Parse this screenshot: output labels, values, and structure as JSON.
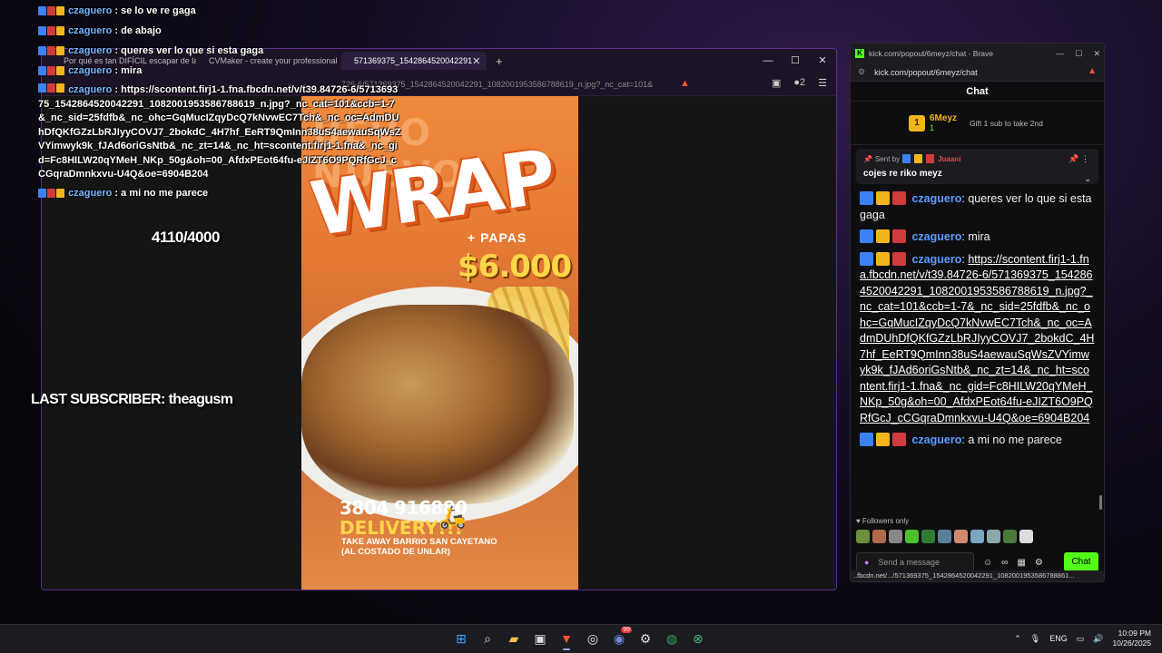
{
  "overlay_chat": {
    "messages": [
      {
        "user": "czaguero",
        "sep": " : ",
        "text": "se lo ve re gaga"
      },
      {
        "user": "czaguero",
        "sep": " : ",
        "text": "de abajo"
      },
      {
        "user": "czaguero",
        "sep": " : ",
        "text": "queres ver lo que si esta gaga"
      },
      {
        "user": "czaguero",
        "sep": " : ",
        "text": "mira"
      },
      {
        "user": "czaguero",
        "sep": " : ",
        "text": "https://scontent.firj1-1.fna.fbcdn.net/v/t39.84726-6/571369375_1542864520042291_1082001953586788619_n.jpg?_nc_cat=101&ccb=1-7&_nc_sid=25fdfb&_nc_ohc=GqMucIZqyDcQ7kNvwEC7Tch&_nc_oc=AdmDUhDfQKfGZzLbRJIyyCOVJ7_2bokdC_4H7hf_EeRT9QmInn38uS4aewauSqWsZVYimwyk9k_fJAd6oriGsNtb&_nc_zt=14&_nc_ht=scontent.firj1-1.fna&_nc_gid=Fc8HILW20qYMeH_NKp_50g&oh=00_AfdxPEot64fu-eJIZT6O9PQRfGcJ_cCGqraDmnkxvu-U4Q&oe=6904B204"
      },
      {
        "user": "czaguero",
        "sep": " : ",
        "text": "a mi no me parece"
      }
    ],
    "counter": "4110/4000",
    "last_subscriber": "LAST SUBSCRIBER: theagusm"
  },
  "browser": {
    "tabs": [
      {
        "label": "Por qué es tan DIFÍCIL escapar de la"
      },
      {
        "label": "CVMaker - create your professional"
      },
      {
        "label": "571369375_1542864520042291"
      }
    ],
    "new_tab": "+",
    "address_fragment": "726-6/571369375_1542864520042291_1082001953586788619_n.jpg?_nc_cat=101&",
    "extension_count": "2"
  },
  "poster": {
    "arch_text": "UEVO NUEVO",
    "title": "WRAP",
    "subtitle": "+ PAPAS",
    "price": "$6.000",
    "phone": "3804 916880",
    "delivery": "DELIVERY!!!",
    "takeaway": "TAKE AWAY BARRIO SAN CAYETANO",
    "location": "(AL COSTADO DE UNLAR)"
  },
  "kick": {
    "window_title": "kick.com/popout/6meyz/chat - Brave",
    "url": "kick.com/popout/6meyz/chat",
    "header": "Chat",
    "gift": {
      "rank": "1",
      "user": "6Meyz",
      "count": "1",
      "text": "Gift 1 sub to take 2nd"
    },
    "pinned": {
      "sent_by_label": "Sent by",
      "sent_by_user": "Juaani",
      "message": "cojes re riko meyz"
    },
    "messages": [
      {
        "user": "czaguero",
        "text": ": queres ver lo que si esta gaga",
        "link": ""
      },
      {
        "user": "czaguero",
        "text": ": mira",
        "link": ""
      },
      {
        "user": "czaguero",
        "text": ": ",
        "link": "https://scontent.firj1-1.fna.fbcdn.net/v/t39.84726-6/571369375_1542864520042291_1082001953586788619_n.jpg?_nc_cat=101&ccb=1-7&_nc_sid=25fdfb&_nc_ohc=GqMucIZqyDcQ7kNvwEC7Tch&_nc_oc=AdmDUhDfQKfGZzLbRJIyyCOVJ7_2bokdC_4H7hf_EeRT9QmInn38uS4aewauSqWsZVYimwyk9k_fJAd6oriGsNtb&_nc_zt=14&_nc_ht=scontent.firj1-1.fna&_nc_gid=Fc8HILW20qYMeH_NKp_50g&oh=00_AfdxPEot64fu-eJIZT6O9PQRfGcJ_cCGqraDmnkxvu-U4Q&oe=6904B204"
      },
      {
        "user": "czaguero",
        "text": ": a mi no me parece",
        "link": ""
      }
    ],
    "followers_only": "Followers only",
    "input_placeholder": "Send a message",
    "chat_button": "Chat",
    "status_url": "..fbcdn.net/.../571369375_1542864520042291_1082001953586788861..."
  },
  "taskbar": {
    "language": "ENG",
    "time": "10:09 PM",
    "date": "10/26/2025",
    "discord_badge": "99"
  },
  "colors": {
    "kick_green": "#53fc18",
    "username_blue": "#5f9bff",
    "accent_purple": "#5a2f8a"
  }
}
